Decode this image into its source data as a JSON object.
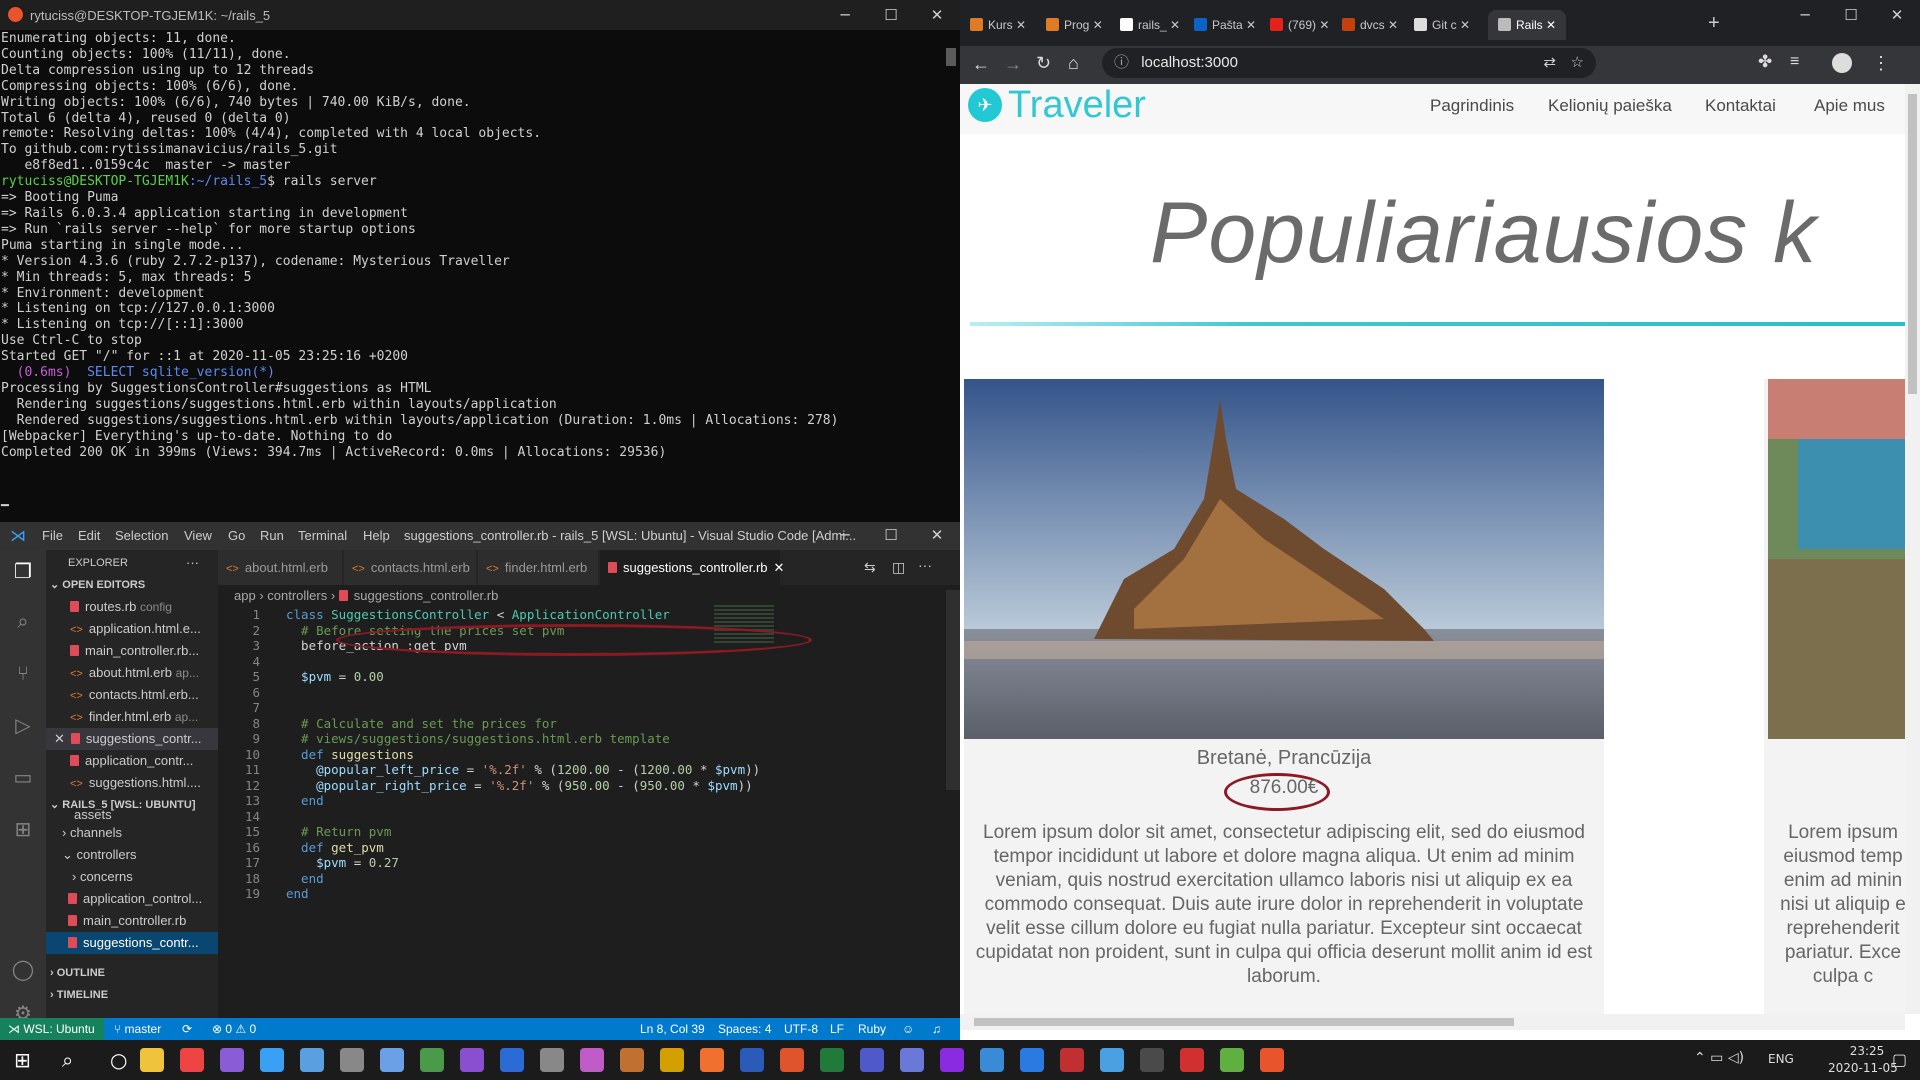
{
  "terminal": {
    "title": "rytuciss@DESKTOP-TGJEM1K: ~/rails_5",
    "lines": [
      "Enumerating objects: 11, done.",
      "Counting objects: 100% (11/11), done.",
      "Delta compression using up to 12 threads",
      "Compressing objects: 100% (6/6), done.",
      "Writing objects: 100% (6/6), 740 bytes | 740.00 KiB/s, done.",
      "Total 6 (delta 4), reused 0 (delta 0)",
      "remote: Resolving deltas: 100% (4/4), completed with 4 local objects.",
      "To github.com:rytissimanavicius/rails_5.git",
      "   e8f8ed1..0159c4c  master -> master"
    ],
    "prompt_user": "rytuciss@DESKTOP-TGJEM1K",
    "prompt_path": ":~/rails_5",
    "prompt_cmd": "$ rails server",
    "lines2": [
      "=> Booting Puma",
      "=> Rails 6.0.3.4 application starting in development",
      "=> Run `rails server --help` for more startup options",
      "Puma starting in single mode...",
      "* Version 4.3.6 (ruby 2.7.2-p137), codename: Mysterious Traveller",
      "* Min threads: 5, max threads: 5",
      "* Environment: development",
      "* Listening on tcp://127.0.0.1:3000",
      "* Listening on tcp://[::1]:3000",
      "Use Ctrl-C to stop",
      "Started GET \"/\" for ::1 at 2020-11-05 23:25:16 +0200"
    ],
    "sql_time": "  (0.6ms)",
    "sql_query": "  SELECT sqlite_version(*)",
    "lines3": [
      "Processing by SuggestionsController#suggestions as HTML",
      "  Rendering suggestions/suggestions.html.erb within layouts/application",
      "  Rendered suggestions/suggestions.html.erb within layouts/application (Duration: 1.0ms | Allocations: 278)",
      "[Webpacker] Everything's up-to-date. Nothing to do",
      "Completed 200 OK in 399ms (Views: 394.7ms | ActiveRecord: 0.0ms | Allocations: 29536)"
    ]
  },
  "vscode": {
    "menu": [
      "File",
      "Edit",
      "Selection",
      "View",
      "Go",
      "Run",
      "Terminal",
      "Help"
    ],
    "window_title": "suggestions_controller.rb - rails_5 [WSL: Ubuntu] - Visual Studio Code [Admi...",
    "explorer_label": "EXPLORER",
    "open_editors_label": "OPEN EDITORS",
    "open_editors": [
      {
        "name": "routes.rb",
        "desc": "config"
      },
      {
        "name": "application.html.e...",
        "desc": ""
      },
      {
        "name": "main_controller.rb...",
        "desc": ""
      },
      {
        "name": "about.html.erb",
        "desc": "ap..."
      },
      {
        "name": "contacts.html.erb...",
        "desc": ""
      },
      {
        "name": "finder.html.erb",
        "desc": "ap..."
      },
      {
        "name": "suggestions_contr...",
        "desc": ""
      },
      {
        "name": "application_contr...",
        "desc": ""
      },
      {
        "name": "suggestions.html....",
        "desc": ""
      }
    ],
    "workspace_label": "RAILS_5 [WSL: UBUNTU]",
    "tree": [
      "assets",
      "channels",
      "controllers",
      "concerns",
      "application_control...",
      "main_controller.rb",
      "suggestions_contr..."
    ],
    "outline_label": "OUTLINE",
    "timeline_label": "TIMELINE",
    "tabs": [
      "about.html.erb",
      "contacts.html.erb",
      "finder.html.erb",
      "suggestions_controller.rb"
    ],
    "breadcrumb": [
      "app",
      "controllers",
      "suggestions_controller.rb"
    ],
    "code_lines": [
      "1",
      "2",
      "3",
      "4",
      "5",
      "6",
      "7",
      "8",
      "9",
      "10",
      "11",
      "12",
      "13",
      "14",
      "15",
      "16",
      "17",
      "18",
      "19"
    ],
    "code": {
      "l1a": "class ",
      "l1b": "SuggestionsController",
      "l1c": " < ",
      "l1d": "ApplicationController",
      "l2": "  # Before setting the prices set pvm",
      "l3": "  before_action :get_pvm",
      "l5a": "  $pvm",
      "l5b": " = ",
      "l5c": "0.00",
      "l8": "  # Calculate and set the prices for",
      "l9": "  # views/suggestions/suggestions.html.erb template",
      "l10a": "  def ",
      "l10b": "suggestions",
      "l11a": "    @popular_left_price",
      "l11b": " = ",
      "l11c": "'%.2f'",
      "l11d": " % (",
      "l11e": "1200.00",
      "l11f": " - (",
      "l11g": "1200.00",
      "l11h": " * ",
      "l11i": "$pvm",
      "l11j": "))",
      "l12a": "    @popular_right_price",
      "l12b": " = ",
      "l12c": "'%.2f'",
      "l12d": " % (",
      "l12e": "950.00",
      "l12f": " - (",
      "l12g": "950.00",
      "l12h": " * ",
      "l12i": "$pvm",
      "l12j": "))",
      "l13": "  end",
      "l15": "  # Return pvm",
      "l16a": "  def ",
      "l16b": "get_pvm",
      "l17a": "    $pvm",
      "l17b": " = ",
      "l17c": "0.27",
      "l18": "  end",
      "l19": "end"
    },
    "status": {
      "remote": "WSL: Ubuntu",
      "branch": "master",
      "problems": "⊗ 0 ⚠ 0",
      "position": "Ln 8, Col 39",
      "spaces": "Spaces: 4",
      "encoding": "UTF-8",
      "eol": "LF",
      "language": "Ruby"
    }
  },
  "browser": {
    "tabs": [
      {
        "label": "Kurs",
        "color": "#e07b24"
      },
      {
        "label": "Prog",
        "color": "#e07b24"
      },
      {
        "label": "rails_",
        "color": "#ffffff"
      },
      {
        "label": "Pašta",
        "color": "#0a64c8"
      },
      {
        "label": "(769)",
        "color": "#e62117"
      },
      {
        "label": "dvcs",
        "color": "#c2410c"
      },
      {
        "label": "Git c",
        "color": "#dddddd"
      },
      {
        "label": "Rails",
        "color": "#bbbbbb"
      }
    ],
    "url": "localhost:3000",
    "page": {
      "brand": "Traveler",
      "nav": [
        "Pagrindinis",
        "Kelionių paieška",
        "Kontaktai",
        "Apie mus"
      ],
      "hero": "Populiariausios k",
      "card_left": {
        "title": "Bretanė, Prancūzija",
        "price": "876.00€",
        "text": "Lorem ipsum dolor sit amet, consectetur adipiscing elit, sed do eiusmod tempor incididunt ut labore et dolore magna aliqua. Ut enim ad minim veniam, quis nostrud exercitation ullamco laboris nisi ut aliquip ex ea commodo consequat. Duis aute irure dolor in reprehenderit in voluptate velit esse cillum dolore eu fugiat nulla pariatur. Excepteur sint occaecat cupidatat non proident, sunt in culpa qui officia deserunt mollit anim id est laborum."
      },
      "card_right_lines": [
        "Lorem ipsum",
        "eiusmod temp",
        "enim ad minin",
        "nisi ut aliquip e",
        "reprehenderit",
        "pariatur. Exce",
        "culpa c"
      ]
    }
  },
  "taskbar": {
    "lang": "ENG",
    "time": "23:25",
    "date": "2020-11-05"
  }
}
